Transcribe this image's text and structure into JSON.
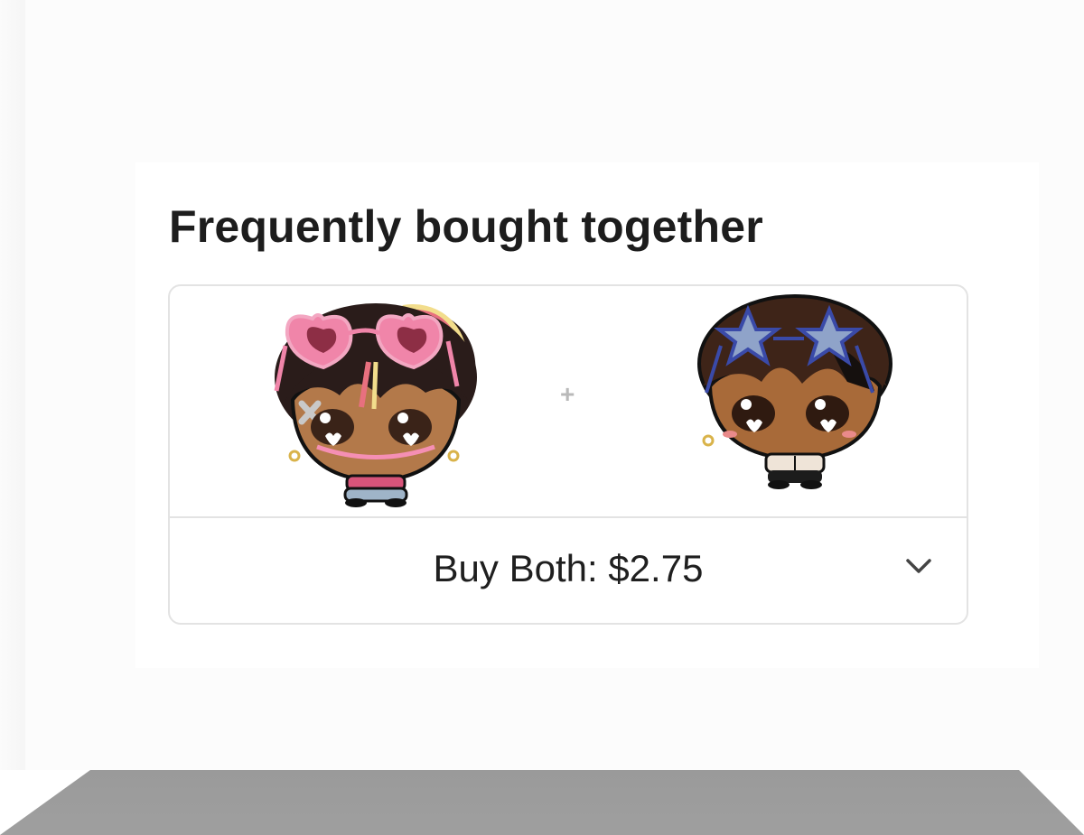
{
  "section": {
    "title": "Frequently bought together"
  },
  "products": [
    {
      "icon": "chibi-character-pink-heart-glasses-image"
    },
    {
      "icon": "chibi-character-blue-star-glasses-image"
    }
  ],
  "plus_symbol": "+",
  "buy_bar": {
    "label": "Buy Both: $2.75",
    "expand_icon": "chevron-down-icon"
  },
  "colors": {
    "border": "#e3e3e3",
    "text": "#1d1d1d"
  }
}
